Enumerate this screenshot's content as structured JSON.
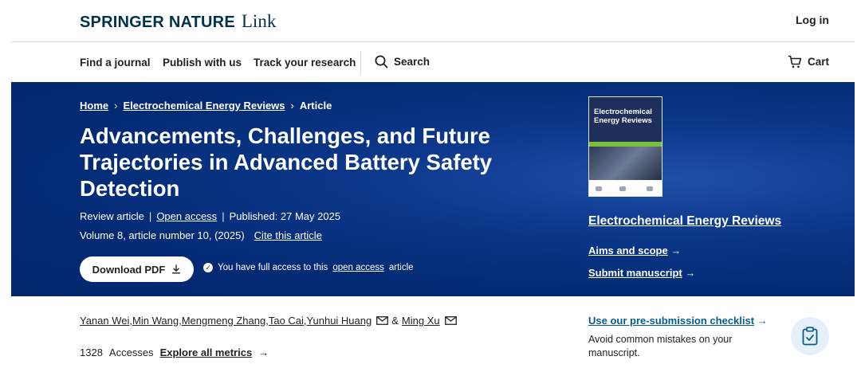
{
  "header": {
    "logo_brand": "SPRINGER NATURE",
    "logo_suffix": "Link",
    "login_label": "Log in"
  },
  "nav": {
    "find_journal": "Find a journal",
    "publish": "Publish with us",
    "track": "Track your research",
    "search": "Search",
    "cart": "Cart"
  },
  "breadcrumb": {
    "home": "Home",
    "journal": "Electrochemical Energy Reviews",
    "current": "Article"
  },
  "article": {
    "title": "Advancements, Challenges, and Future Trajectories in Advanced Battery Safety Detection",
    "type": "Review article",
    "access": "Open access",
    "published": "Published: 27 May 2025",
    "volume": "Volume 8, article number 10, (2025)",
    "cite": "Cite this article",
    "download_label": "Download PDF",
    "access_note_prefix": "You have full access to this",
    "access_note_link": "open access",
    "access_note_suffix": "article"
  },
  "journal": {
    "cover_title": "Electrochemical Energy Reviews",
    "name": "Electrochemical Energy Reviews",
    "aims": "Aims and scope",
    "submit": "Submit manuscript"
  },
  "authors": [
    {
      "name": "Yanan Wei",
      "sep": ", "
    },
    {
      "name": "Min Wang",
      "sep": ", "
    },
    {
      "name": "Mengmeng Zhang",
      "sep": ", "
    },
    {
      "name": "Tao Cai",
      "sep": ", "
    },
    {
      "name": "Yunhui Huang",
      "sep": ""
    },
    {
      "name": "Ming Xu",
      "sep": ""
    }
  ],
  "authors_amp": "&",
  "metrics": {
    "accesses_count": "1328",
    "accesses_label": "Accesses",
    "explore": "Explore all metrics"
  },
  "checklist": {
    "link": "Use our pre-submission checklist",
    "desc": "Avoid common mistakes on your manuscript."
  },
  "colors": {
    "hero_bg": "#032a73",
    "brand": "#01324b",
    "link_blue": "#025e8d"
  }
}
